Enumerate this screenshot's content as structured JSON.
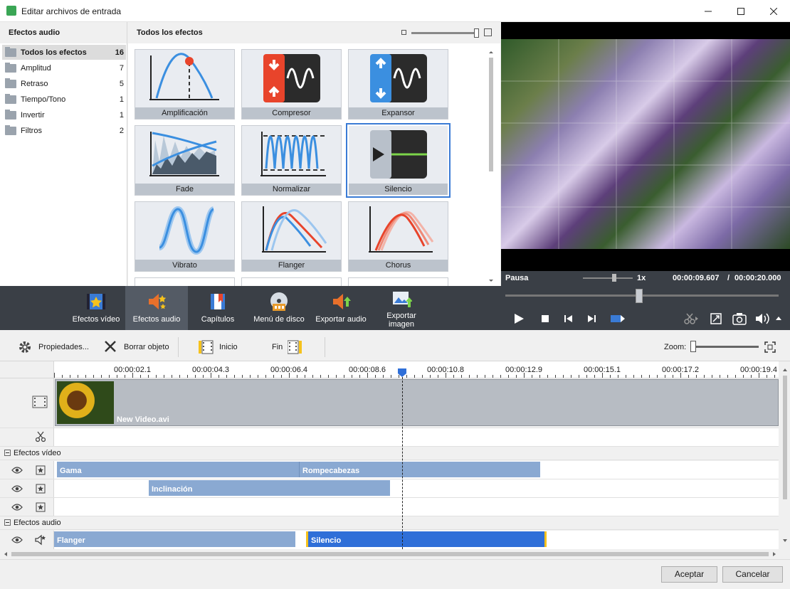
{
  "window": {
    "title": "Editar archivos de entrada"
  },
  "categories": {
    "header": "Efectos audio",
    "items": [
      {
        "label": "Todos los efectos",
        "count": "16"
      },
      {
        "label": "Amplitud",
        "count": "7"
      },
      {
        "label": "Retraso",
        "count": "5"
      },
      {
        "label": "Tiempo/Tono",
        "count": "1"
      },
      {
        "label": "Invertir",
        "count": "1"
      },
      {
        "label": "Filtros",
        "count": "2"
      }
    ]
  },
  "effects": {
    "header": "Todos los efectos",
    "tiles": [
      {
        "label": "Amplificación"
      },
      {
        "label": "Compresor"
      },
      {
        "label": "Expansor"
      },
      {
        "label": "Fade"
      },
      {
        "label": "Normalizar"
      },
      {
        "label": "Silencio"
      },
      {
        "label": "Vibrato"
      },
      {
        "label": "Flanger"
      },
      {
        "label": "Chorus"
      }
    ]
  },
  "preview": {
    "status": "Pausa",
    "speed": "1x",
    "current_time": "00:00:09.607",
    "separator": "/",
    "total_time": "00:00:20.000",
    "seek_fraction": 0.48
  },
  "toolbar": {
    "items": [
      {
        "label": "Efectos vídeo"
      },
      {
        "label": "Efectos audio"
      },
      {
        "label": "Capítulos"
      },
      {
        "label": "Menú de disco"
      },
      {
        "label": "Exportar audio"
      },
      {
        "label": "Exportar imagen"
      }
    ]
  },
  "tltools": {
    "properties": "Propiedades...",
    "delete": "Borrar objeto",
    "start": "Inicio",
    "end": "Fin",
    "zoom": "Zoom:"
  },
  "ruler": {
    "labels": [
      "00:00:02.1",
      "00:00:04.3",
      "00:00:06.4",
      "00:00:08.6",
      "00:00:10.8",
      "00:00:12.9",
      "00:00:15.1",
      "00:00:17.2",
      "00:00:19.4"
    ]
  },
  "timeline": {
    "video_clip": "New Video.avi",
    "video_section": "Efectos vídeo",
    "audio_section": "Efectos audio",
    "video_fx": [
      {
        "label": "Gama"
      },
      {
        "label": "Rompecabezas"
      },
      {
        "label": "Inclinación"
      }
    ],
    "audio_fx": [
      {
        "label": "Flanger"
      },
      {
        "label": "Silencio"
      }
    ]
  },
  "footer": {
    "accept": "Aceptar",
    "cancel": "Cancelar"
  },
  "colors": {
    "accent": "#3a7bd5",
    "dark_toolbar": "#3a3f46",
    "clip_blue": "#8aa9d2"
  }
}
